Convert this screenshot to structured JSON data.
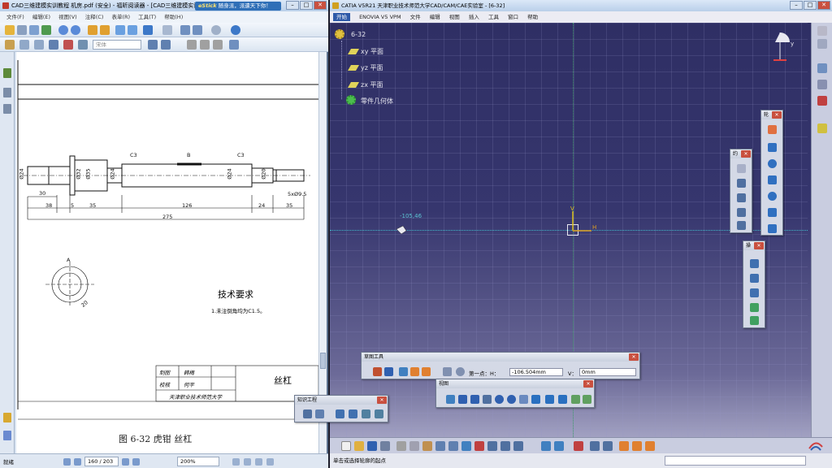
{
  "pdf": {
    "title": "CAD三维建模实训教程 机房.pdf (安全) - 福昕阅读器 - [CAD三维建模实训教程 机房.pdf (安全)]",
    "promo_brand": "eStick",
    "promo_text": "随身派，派遣天下你！",
    "menu": [
      "文件(F)",
      "编辑(E)",
      "视图(V)",
      "注释(C)",
      "表单(R)",
      "工具(T)",
      "帮助(H)"
    ],
    "font_select": "宋体",
    "drawing": {
      "chamfer_left": "C3",
      "chamfer_right": "C3",
      "dim_b": "B",
      "dia_left": "Ø24",
      "dia_2": "Ø32",
      "dia_3": "Ø35",
      "dia_4": "Ø24",
      "dia_5": "Ø24",
      "dia_6": "Ø20",
      "thread": "5xØ9.5",
      "l_30": "30",
      "l_38": "38",
      "l_5": "5",
      "l_35": "35",
      "l_126": "126",
      "l_24": "24",
      "l_35b": "35",
      "l_275": "275",
      "section_a": "A",
      "section_dim": "20",
      "tech_title": "技术要求",
      "tech_note": "1.未注倒角均为C1.5。",
      "tbl_draw": "制图",
      "tbl_draw_name": "韩梅",
      "tbl_check": "校核",
      "tbl_check_name": "何平",
      "tbl_school": "天津职业技术师范大学",
      "part_name": "丝杠",
      "caption": "图 6-32 虎钳 丝杠"
    },
    "status_left": "就绪",
    "page_box": "160 / 203",
    "zoom_box": "200%"
  },
  "knowledge_toolbar": {
    "title": "知识工程"
  },
  "catia": {
    "title": "CATIA V5R21 天津职业技术师范大学CAD/CAM/CAE实验室 - [6-32]",
    "menu": [
      "开始",
      "ENOVIA V5 VPM",
      "文件",
      "编辑",
      "视图",
      "插入",
      "工具",
      "窗口",
      "帮助"
    ],
    "tree": {
      "root": "6-32",
      "xy": "xy 平面",
      "yz": "yz 平面",
      "zx": "zx 平面",
      "body": "零件几何体"
    },
    "coord_readout": "-105,46",
    "axis_h": "H",
    "axis_v": "V",
    "sketch_tools": {
      "title": "草图工具",
      "first_point_label": "第一点：H：",
      "h_value": "-106.504mm",
      "v_label": "V：",
      "v_value": "0mm"
    },
    "view_toolbar": {
      "title": "视图"
    },
    "profile_toolbar": {
      "title": "轮"
    },
    "constraint_toolbar": {
      "title": "约"
    },
    "ops_toolbar": {
      "title": "操"
    },
    "status_text": "单击或选择轮廓的起点"
  },
  "colors": {
    "catia_bg_top": "#2e2e63",
    "catia_bg_bottom": "#bcbcd6",
    "axis_h": "#e0a020",
    "axis_v": "#e0c020",
    "tree_text": "#e8e8f0"
  }
}
